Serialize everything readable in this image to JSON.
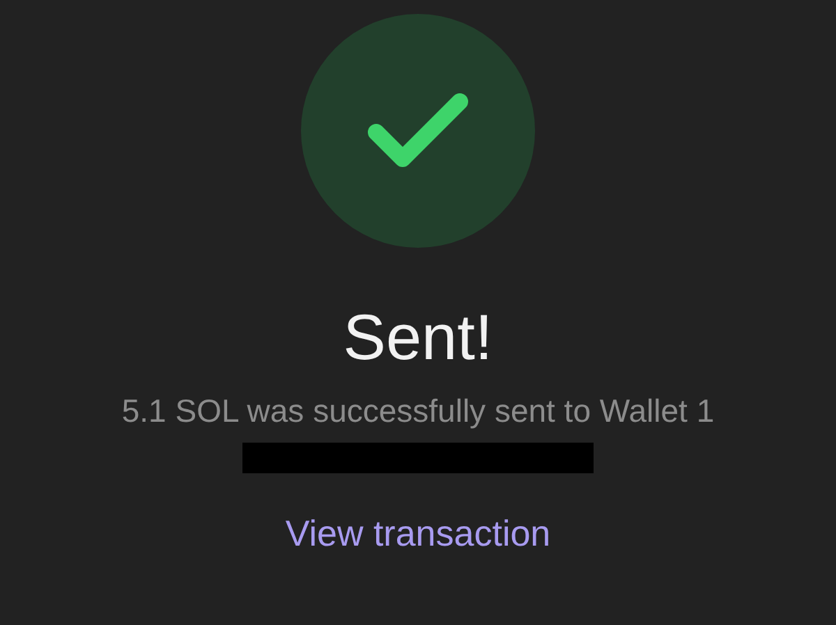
{
  "status": {
    "kind": "success"
  },
  "title": "Sent!",
  "message": "5.1 SOL was successfully sent to Wallet 1",
  "recipient_address": {
    "redacted": true
  },
  "link": "View transaction"
}
